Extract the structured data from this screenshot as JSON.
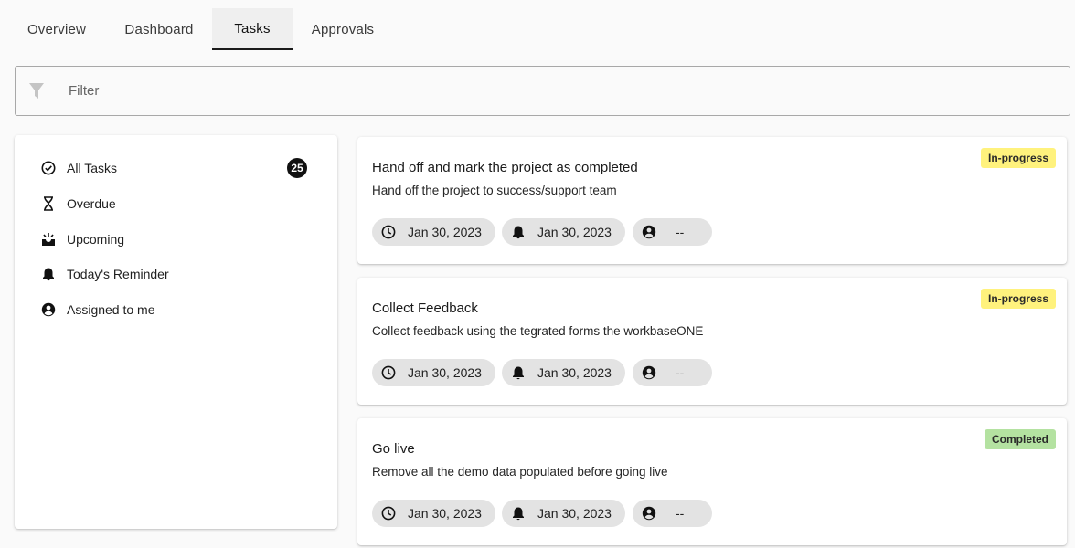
{
  "tabs": [
    {
      "label": "Overview"
    },
    {
      "label": "Dashboard"
    },
    {
      "label": "Tasks",
      "active": true
    },
    {
      "label": "Approvals"
    }
  ],
  "filter": {
    "placeholder": "Filter",
    "icon": "filter-icon"
  },
  "sidebar": {
    "items": [
      {
        "label": "All Tasks",
        "icon": "check-circle-icon",
        "count": "25"
      },
      {
        "label": "Overdue",
        "icon": "hourglass-icon"
      },
      {
        "label": "Upcoming",
        "icon": "upcoming-icon"
      },
      {
        "label": "Today's Reminder",
        "icon": "bell-icon"
      },
      {
        "label": "Assigned to me",
        "icon": "account-circle-icon"
      }
    ]
  },
  "status_colors": {
    "In-progress": "#fff27d",
    "Completed": "#b4e2a1"
  },
  "tasks": [
    {
      "title": "Hand off and mark the project as completed",
      "description": "Hand off the project to success/support team",
      "status": "In-progress",
      "due": "Jan 30, 2023",
      "reminder": "Jan 30, 2023",
      "assignee": "--"
    },
    {
      "title": "Collect Feedback",
      "description": "Collect feedback using the tegrated forms the workbaseONE",
      "status": "In-progress",
      "due": "Jan 30, 2023",
      "reminder": "Jan 30, 2023",
      "assignee": "--"
    },
    {
      "title": "Go live",
      "description": "Remove all the demo data populated before going live",
      "status": "Completed",
      "due": "Jan 30, 2023",
      "reminder": "Jan 30, 2023",
      "assignee": "--"
    }
  ]
}
